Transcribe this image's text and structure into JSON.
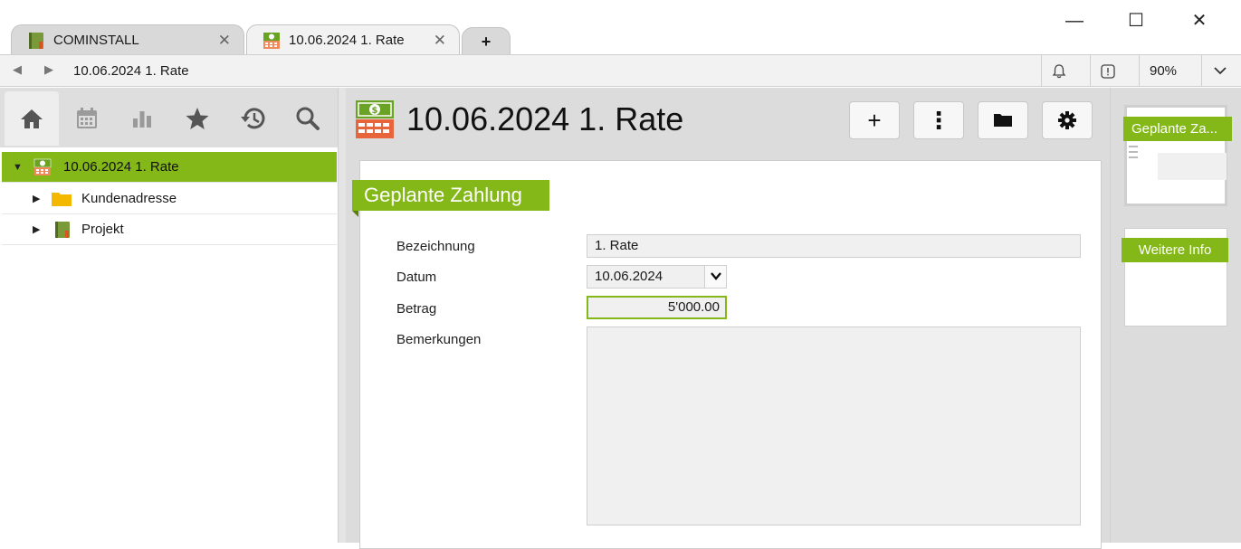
{
  "window": {
    "minimize": "—",
    "maximize": "☐",
    "close": "✕"
  },
  "tabs": [
    {
      "label": "COMINSTALL",
      "close": "✕"
    },
    {
      "label": "10.06.2024 1. Rate",
      "close": "✕"
    }
  ],
  "new_tab": "+",
  "address_bar": {
    "back": "◀",
    "forward": "▶",
    "path": "10.06.2024 1. Rate",
    "zoom": "90%"
  },
  "tree": [
    {
      "label": "10.06.2024 1. Rate",
      "expanded": true,
      "selected": true
    },
    {
      "label": "Kundenadresse",
      "expanded": false
    },
    {
      "label": "Projekt",
      "expanded": false
    }
  ],
  "header": {
    "title": "10.06.2024 1. Rate",
    "add_label": "+",
    "more_label": "⋮"
  },
  "form": {
    "section_title": "Geplante Zahlung",
    "fields": {
      "bezeichnung": {
        "label": "Bezeichnung",
        "value": "1. Rate"
      },
      "datum": {
        "label": "Datum",
        "value": "10.06.2024"
      },
      "betrag": {
        "label": "Betrag",
        "value": "5'000.00"
      },
      "bemerkungen": {
        "label": "Bemerkungen",
        "value": ""
      }
    }
  },
  "sidebar_thumbnails": [
    {
      "label": "Geplante Za..."
    },
    {
      "label": "Weitere Info"
    }
  ],
  "colors": {
    "accent": "#84b818",
    "selected_row": "#84b818",
    "panel_bg": "#dcdcdc"
  }
}
